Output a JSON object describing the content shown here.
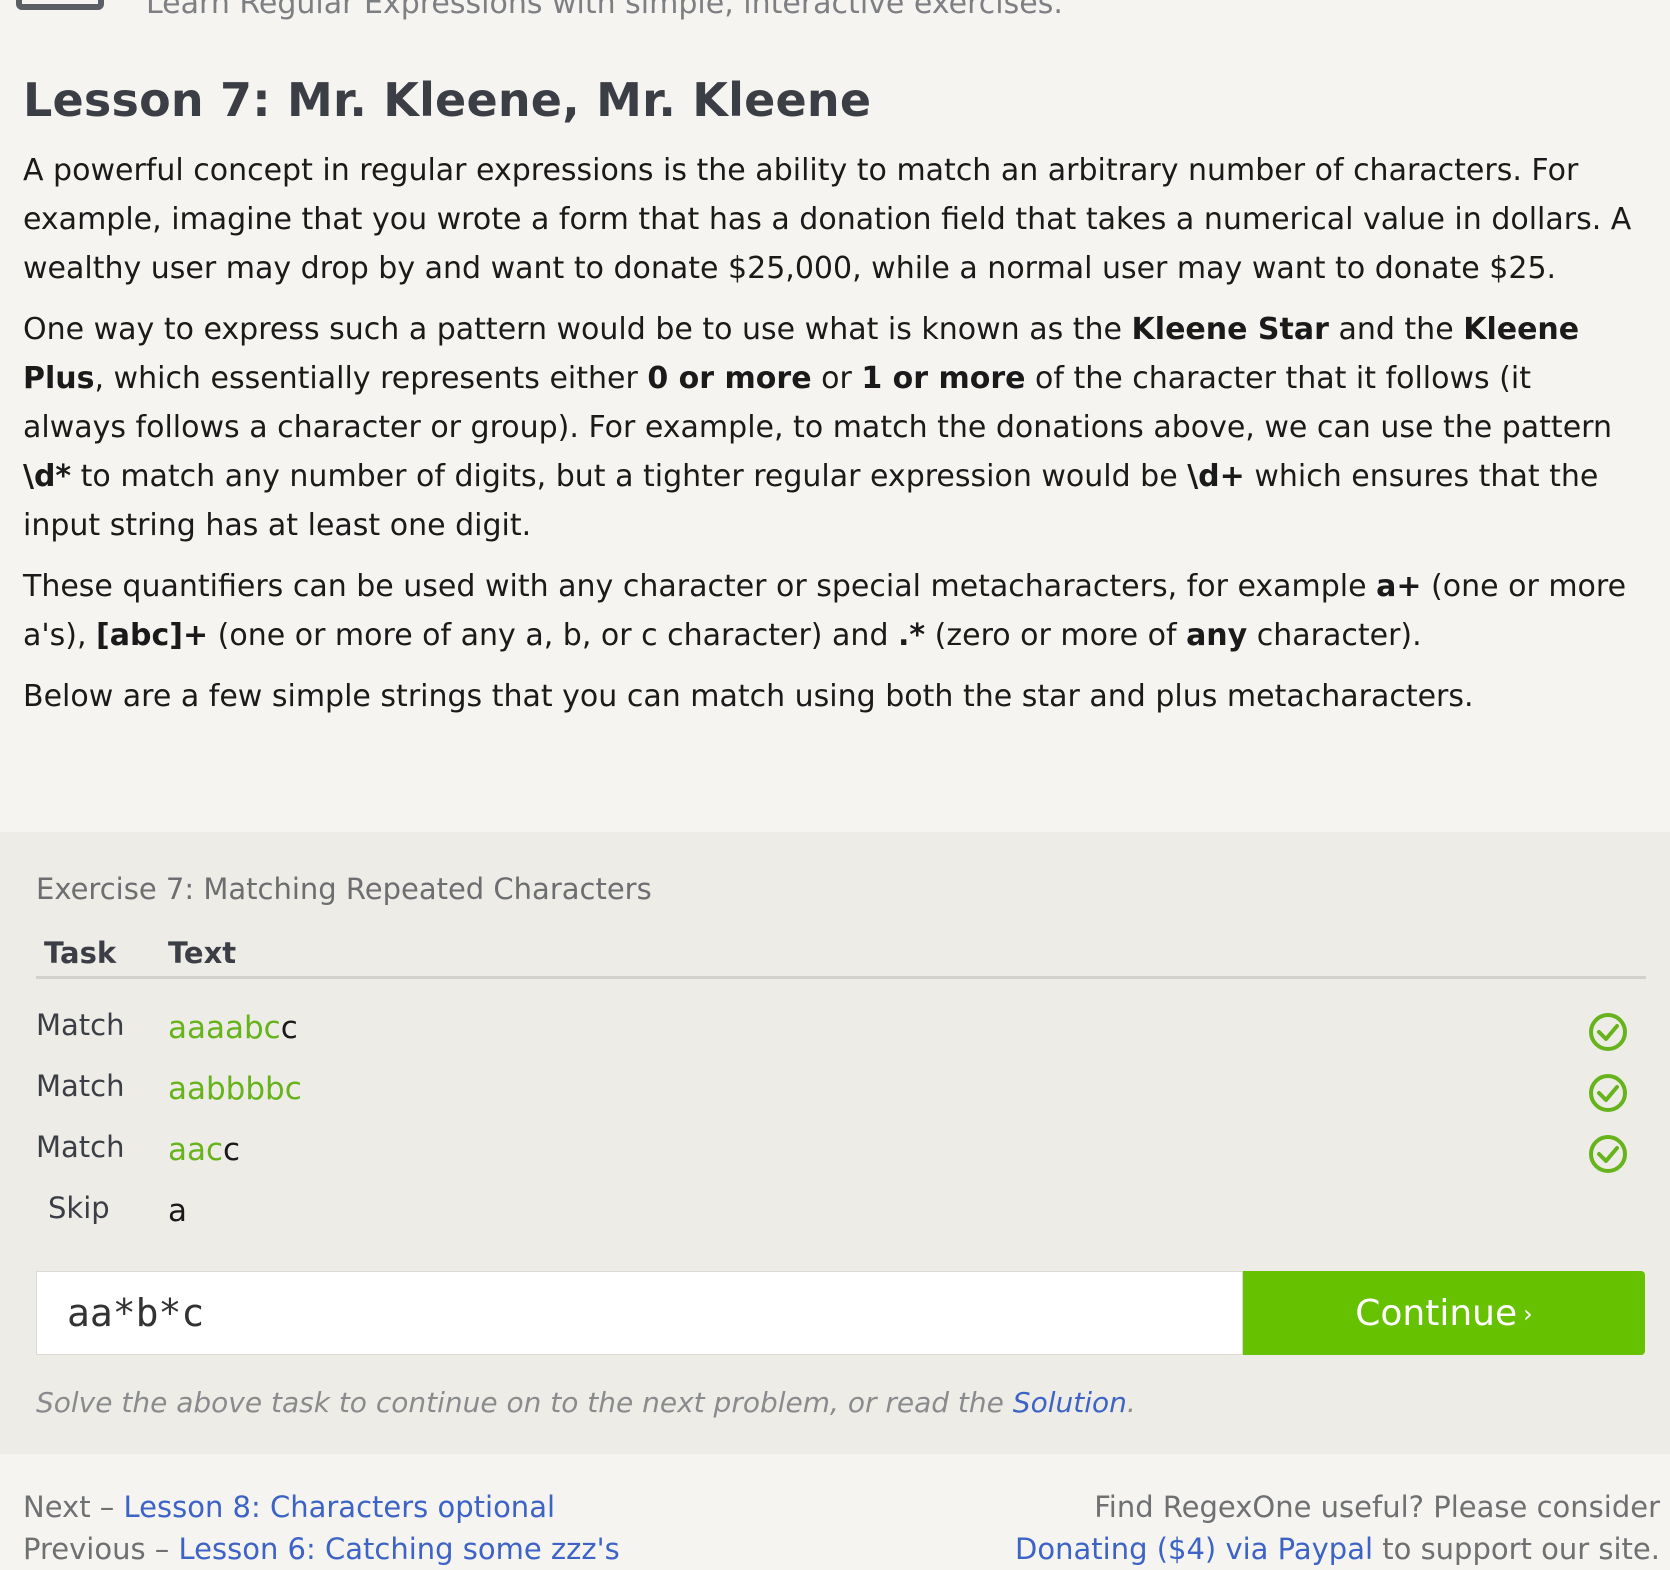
{
  "header": {
    "tagline": "Learn Regular Expressions with simple, interactive exercises."
  },
  "lesson": {
    "title": "Lesson 7: Mr. Kleene, Mr. Kleene",
    "p1": "A powerful concept in regular expressions is the ability to match an arbitrary number of characters. For example, imagine that you wrote a form that has a donation field that takes a numerical value in dollars. A wealthy user may drop by and want to donate $25,000, while a normal user may want to donate $25.",
    "p2": {
      "t1": "One way to express such a pattern would be to use what is known as the ",
      "b1": "Kleene Star",
      "t2": " and the ",
      "b2": "Kleene Plus",
      "t3": ", which essentially represents either ",
      "b3": "0 or more",
      "t4": " or ",
      "b4": "1 or more",
      "t5": " of the character that it follows (it always follows a character or group). For example, to match the donations above, we can use the pattern ",
      "b5": "\\d*",
      "t6": " to match any number of digits, but a tighter regular expression would be ",
      "b6": "\\d+",
      "t7": " which ensures that the input string has at least one digit."
    },
    "p3": {
      "t1": "These quantifiers can be used with any character or special metacharacters, for example ",
      "b1": "a+",
      "t2": " (one or more a's), ",
      "b2": "[abc]+",
      "t3": " (one or more of any a, b, or c character) and ",
      "b3": ".*",
      "t4": " (zero or more of ",
      "b4": "any",
      "t5": " character)."
    },
    "p4": "Below are a few simple strings that you can match using both the star and plus metacharacters."
  },
  "exercise": {
    "title": "Exercise 7: Matching Repeated Characters",
    "col_task": "Task",
    "col_text": "Text",
    "rows": [
      {
        "task": "Match",
        "matched": "aaaabc",
        "rest": "c",
        "status": "check-circle-icon"
      },
      {
        "task": "Match",
        "matched": "aabbbbc",
        "rest": "",
        "status": "check-circle-icon"
      },
      {
        "task": "Match",
        "matched": "aac",
        "rest": "c",
        "status": "check-circle-icon"
      },
      {
        "task": "Skip",
        "matched": "",
        "rest": "a",
        "status": ""
      }
    ],
    "input_value": "aa*b*c",
    "continue_label": "Continue",
    "continue_chevron": "›",
    "hint_text": "Solve the above task to continue on to the next problem, or read the ",
    "hint_link": "Solution",
    "hint_end": "."
  },
  "footer": {
    "next_label": "Next – ",
    "next_link": "Lesson 8: Characters optional",
    "prev_label": "Previous – ",
    "prev_link": "Lesson 6: Catching some zzz's",
    "right_line1": "Find RegexOne useful? Please consider",
    "donate_link": "Donating ($4) via Paypal",
    "right_line2_end": " to support our site."
  },
  "colors": {
    "accent_green": "#66c100",
    "match_green": "#66b31b",
    "link_blue": "#3c63c5",
    "background": "#f5f4f0",
    "exercise_bg": "#eeece7"
  }
}
